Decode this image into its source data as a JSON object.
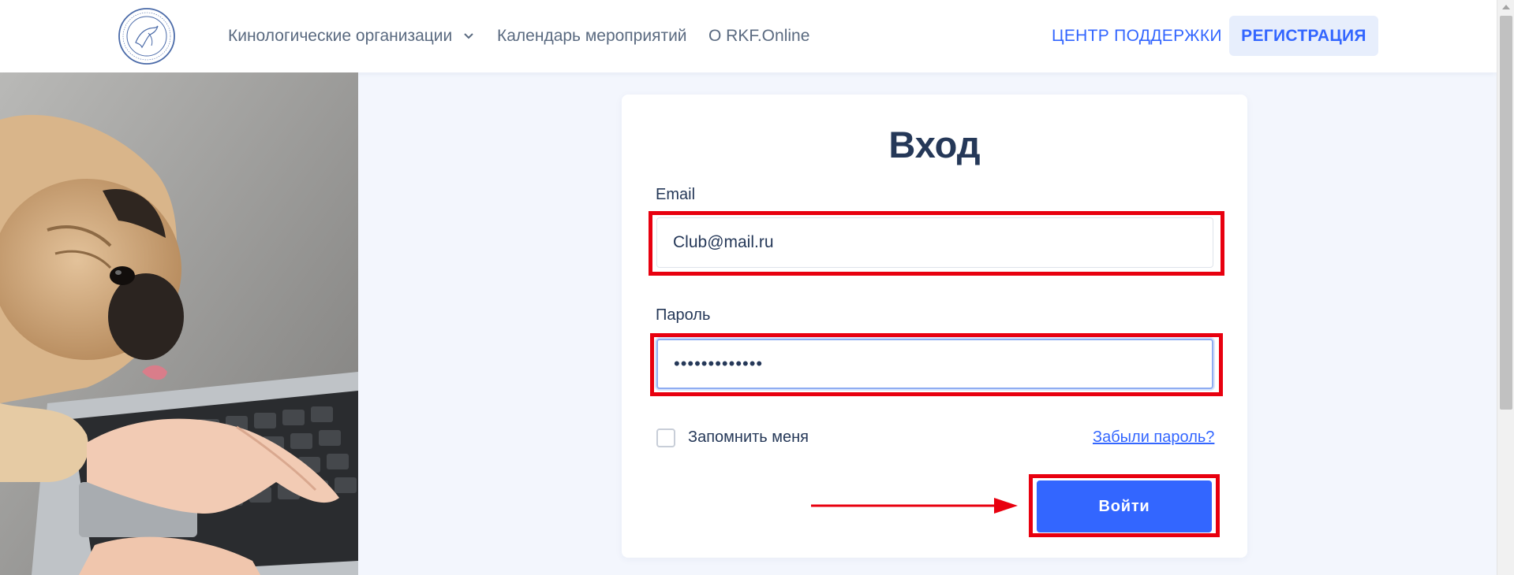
{
  "header": {
    "logo_name": "rkf-logo",
    "nav": [
      {
        "label": "Кинологические организации",
        "has_dropdown": true
      },
      {
        "label": "Календарь мероприятий"
      },
      {
        "label": "О RKF.Online"
      }
    ],
    "support_label": "ЦЕНТР ПОДДЕРЖКИ",
    "register_label": "РЕГИСТРАЦИЯ"
  },
  "login": {
    "title": "Вход",
    "email_label": "Email",
    "email_value": "Club@mail.ru",
    "password_label": "Пароль",
    "password_value": "•••••••••••••",
    "remember_label": "Запомнить меня",
    "remember_checked": false,
    "forgot_label": "Забыли пароль?",
    "submit_label": "Войти"
  },
  "colors": {
    "accent": "#3366ff",
    "highlight": "#e8000f",
    "title": "#253858",
    "background": "#f3f6fd"
  }
}
